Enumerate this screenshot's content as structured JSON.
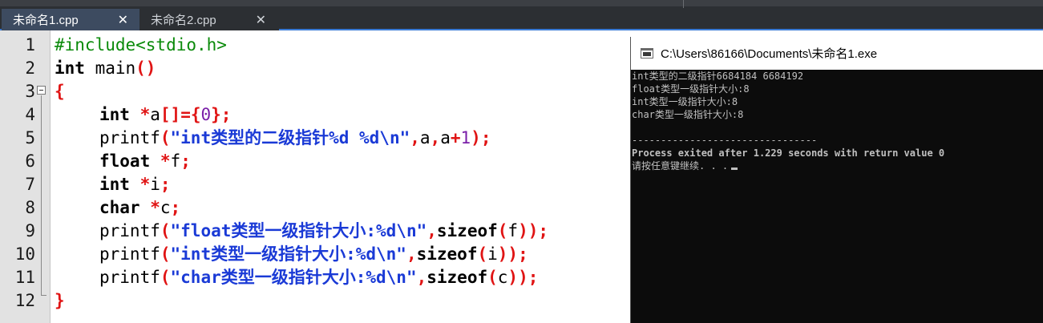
{
  "tabs": [
    {
      "label": "未命名1.cpp",
      "close": "✕"
    },
    {
      "label": "未命名2.cpp",
      "close": "✕"
    }
  ],
  "editor": {
    "line_numbers": [
      "1",
      "2",
      "3",
      "4",
      "5",
      "6",
      "7",
      "8",
      "9",
      "10",
      "11",
      "12"
    ],
    "tokens": {
      "l1_inc": "#include<stdio.h>",
      "l2_int": "int",
      "l2_main": " main",
      "l2_paren": "()",
      "l3_brace": "{",
      "l4_int": "int",
      "l4_sp": " ",
      "l4_star": "*",
      "l4_a": "a",
      "l4_sym1": "[]={",
      "l4_zero": "0",
      "l4_sym2": "};",
      "l5_printf": "printf",
      "l5_po": "(",
      "l5_str": "\"int类型的二级指针%d %d\\n\"",
      "l5_c1": ",",
      "l5_a1": "a",
      "l5_c2": ",",
      "l5_a2": "a",
      "l5_plus": "+",
      "l5_one": "1",
      "l5_end": ");",
      "l6_float": "float",
      "l6_sp": " ",
      "l6_star": "*",
      "l6_f": "f",
      "l6_semi": ";",
      "l7_int": "int",
      "l7_sp": " ",
      "l7_star": "*",
      "l7_i": "i",
      "l7_semi": ";",
      "l8_char": "char",
      "l8_sp": " ",
      "l8_star": "*",
      "l8_c": "c",
      "l8_semi": ";",
      "l9_printf": "printf",
      "l9_po": "(",
      "l9_str": "\"float类型一级指针大小:%d\\n\"",
      "l9_c": ",",
      "l9_sizeof": "sizeof",
      "l9_po2": "(",
      "l9_arg": "f",
      "l9_end": "));",
      "l10_printf": "printf",
      "l10_po": "(",
      "l10_str": "\"int类型一级指针大小:%d\\n\"",
      "l10_c": ",",
      "l10_sizeof": "sizeof",
      "l10_po2": "(",
      "l10_arg": "i",
      "l10_end": "));",
      "l11_printf": "printf",
      "l11_po": "(",
      "l11_str": "\"char类型一级指针大小:%d\\n\"",
      "l11_c": ",",
      "l11_sizeof": "sizeof",
      "l11_po2": "(",
      "l11_arg": "c",
      "l11_end": "));",
      "l12_brace": "}"
    }
  },
  "console": {
    "title": "C:\\Users\\86166\\Documents\\未命名1.exe",
    "lines": [
      "int类型的二级指针6684184 6684192",
      "float类型一级指针大小:8",
      "int类型一级指针大小:8",
      "char类型一级指针大小:8",
      "",
      "--------------------------------",
      "Process exited after 1.229 seconds with return value 0",
      "请按任意键继续. . ."
    ]
  },
  "colors": {
    "preprocessor": "#0a8a0a",
    "symbol": "#e01414",
    "string": "#1a3ad6",
    "number": "#7a1fa8",
    "console_bg": "#0c0c0c",
    "console_text": "#c0c0c0"
  }
}
